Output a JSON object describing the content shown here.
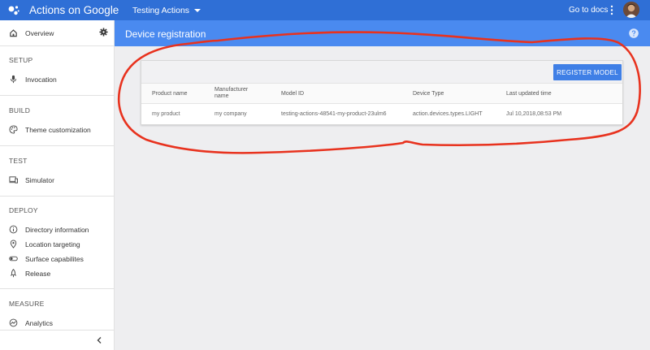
{
  "header": {
    "app_title": "Actions on Google",
    "project": "Testing Actions",
    "docs_link": "Go to docs"
  },
  "sidebar": {
    "overview": "Overview",
    "sections": [
      {
        "heading": "SETUP",
        "items": [
          "Invocation"
        ]
      },
      {
        "heading": "BUILD",
        "items": [
          "Theme customization"
        ]
      },
      {
        "heading": "TEST",
        "items": [
          "Simulator"
        ]
      },
      {
        "heading": "DEPLOY",
        "items": [
          "Directory information",
          "Location targeting",
          "Surface capabilites",
          "Release"
        ]
      },
      {
        "heading": "MEASURE",
        "items": [
          "Analytics"
        ]
      }
    ]
  },
  "page": {
    "title": "Device registration",
    "register_button": "REGISTER MODEL",
    "table": {
      "columns": [
        "Product name",
        "Manufacturer name",
        "Model ID",
        "Device Type",
        "Last updated time"
      ],
      "rows": [
        [
          "my product",
          "my company",
          "testing-actions-48541-my-product-23ulm6",
          "action.devices.types.LIGHT",
          "Jul 10,2018,08:53 PM"
        ]
      ]
    }
  },
  "colors": {
    "topbar": "#2f6fd6",
    "page_band": "#4a8af0",
    "button": "#3f7fe6",
    "annotation": "#e8321e"
  }
}
